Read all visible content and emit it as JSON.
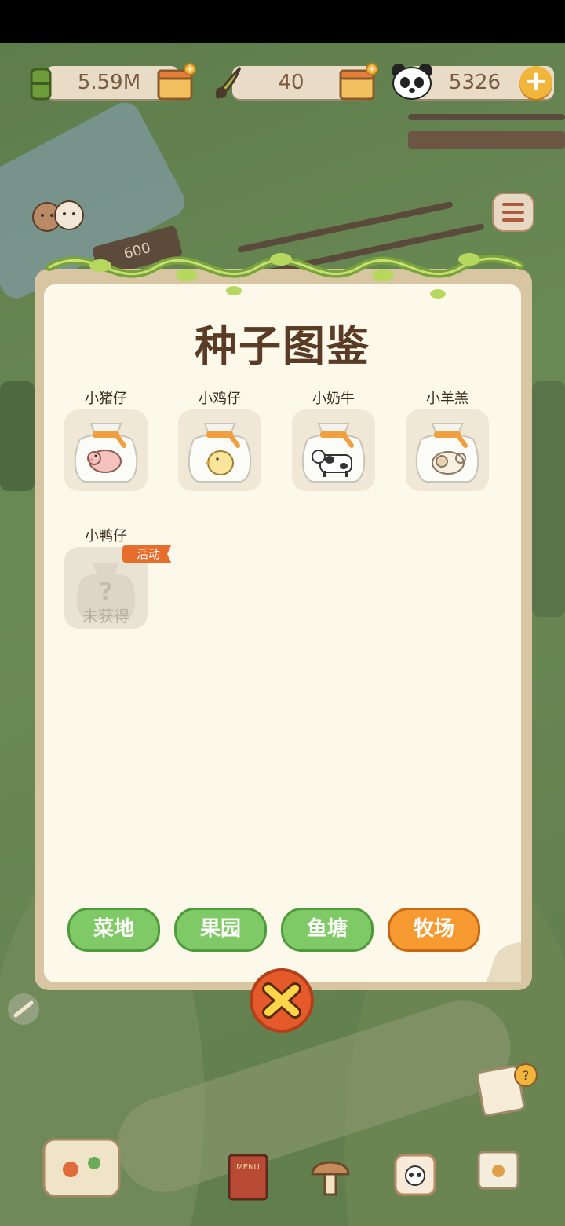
{
  "resources": {
    "bamboo": {
      "value": "5.59M",
      "icon": "bamboo-icon"
    },
    "feather": {
      "value": "40",
      "icon": "leaf-icon"
    },
    "panda_coin": {
      "value": "5326",
      "icon": "panda-icon"
    }
  },
  "sign_text": "600",
  "dialog": {
    "title": "种子图鉴",
    "cards": [
      {
        "label": "小猪仔",
        "animal": "pig",
        "locked": false
      },
      {
        "label": "小鸡仔",
        "animal": "chick",
        "locked": false
      },
      {
        "label": "小奶牛",
        "animal": "cow",
        "locked": false
      },
      {
        "label": "小羊羔",
        "animal": "sheep",
        "locked": false
      },
      {
        "label": "小鸭仔",
        "animal": "duck",
        "locked": true,
        "badge": "活动",
        "locked_text": "未获得",
        "question_mark": "?"
      }
    ],
    "tabs": [
      {
        "label": "菜地",
        "active": false
      },
      {
        "label": "果园",
        "active": false
      },
      {
        "label": "鱼塘",
        "active": false
      },
      {
        "label": "牧场",
        "active": true
      }
    ]
  },
  "menu_sign_text": "MENU",
  "colors": {
    "tab_green": "#7fca66",
    "tab_active": "#f79a32",
    "badge": "#e66d2c",
    "title": "#5a3c26",
    "close_button": "#e45a2a"
  }
}
